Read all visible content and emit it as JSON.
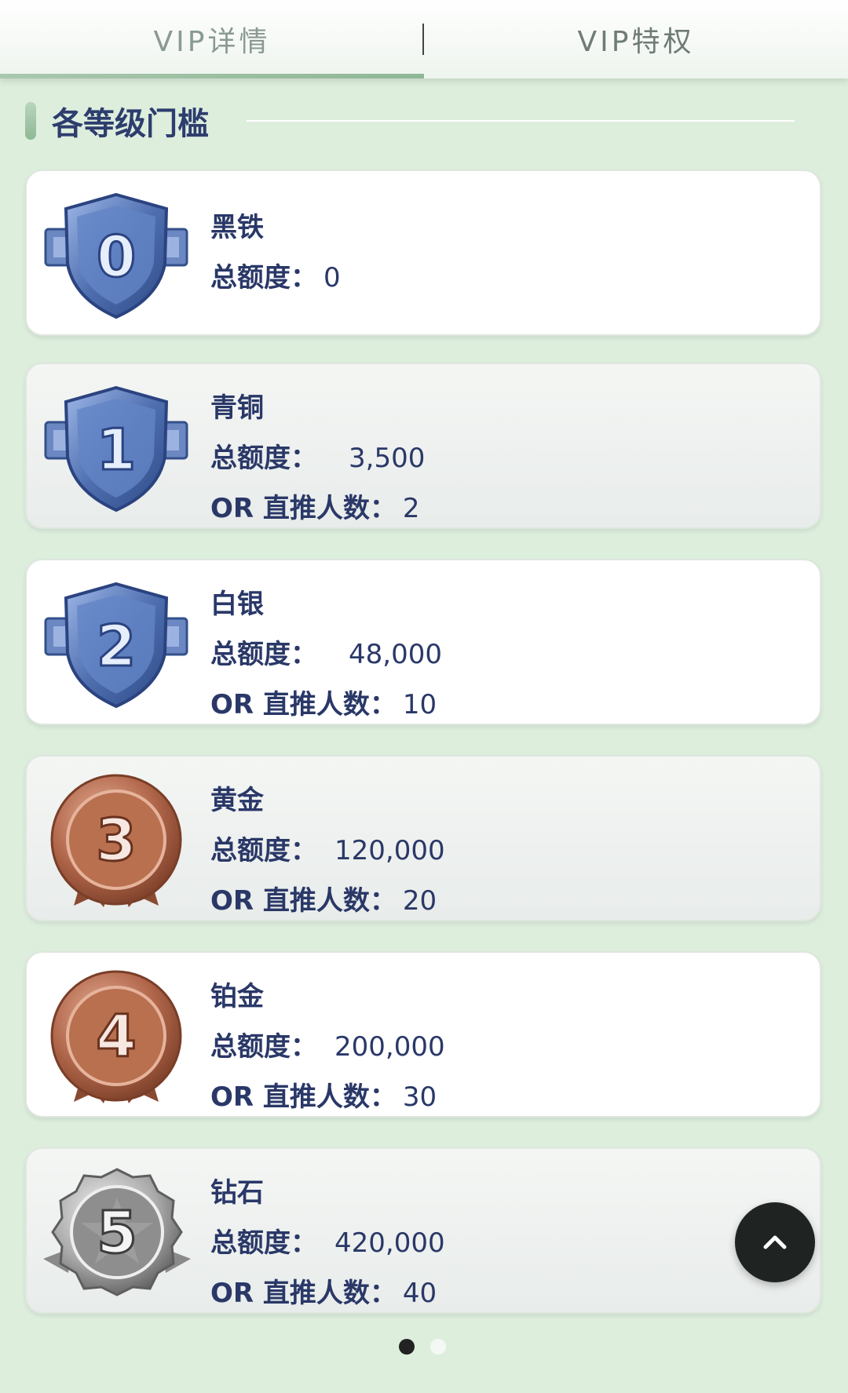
{
  "tabs": [
    {
      "label": "VIP详情"
    },
    {
      "label": "VIP特权"
    }
  ],
  "section": {
    "title": "各等级门槛"
  },
  "levels": [
    {
      "badge_number": "0",
      "name": "黑铁",
      "total_label": "总额度：",
      "total_value": "0"
    },
    {
      "badge_number": "1",
      "name": "青铜",
      "total_label": "总额度：",
      "total_value": "3,500",
      "referral_label": "OR 直推人数：",
      "referral_value": "2"
    },
    {
      "badge_number": "2",
      "name": "白银",
      "total_label": "总额度：",
      "total_value": "48,000",
      "referral_label": "OR 直推人数：",
      "referral_value": "10"
    },
    {
      "badge_number": "3",
      "name": "黄金",
      "total_label": "总额度：",
      "total_value": "120,000",
      "referral_label": "OR 直推人数：",
      "referral_value": "20"
    },
    {
      "badge_number": "4",
      "name": "铂金",
      "total_label": "总额度：",
      "total_value": "200,000",
      "referral_label": "OR 直推人数：",
      "referral_value": "30"
    },
    {
      "badge_number": "5",
      "name": "钻石",
      "total_label": "总额度：",
      "total_value": "420,000",
      "referral_label": "OR 直推人数：",
      "referral_value": "40"
    }
  ],
  "colors": {
    "background": "#ddeedd",
    "text": "#2a3868",
    "shield": "#5b7fc0",
    "bronze": "#b0664a",
    "silver": "#a9a9a9"
  },
  "icons": {
    "shield_badge": "shield-badge-icon",
    "bronze_medal": "bronze-medal-icon",
    "silver_medal": "silver-medal-icon",
    "back_to_top": "chevron-up-icon"
  },
  "pager": {
    "pages": 2,
    "active": 1
  }
}
